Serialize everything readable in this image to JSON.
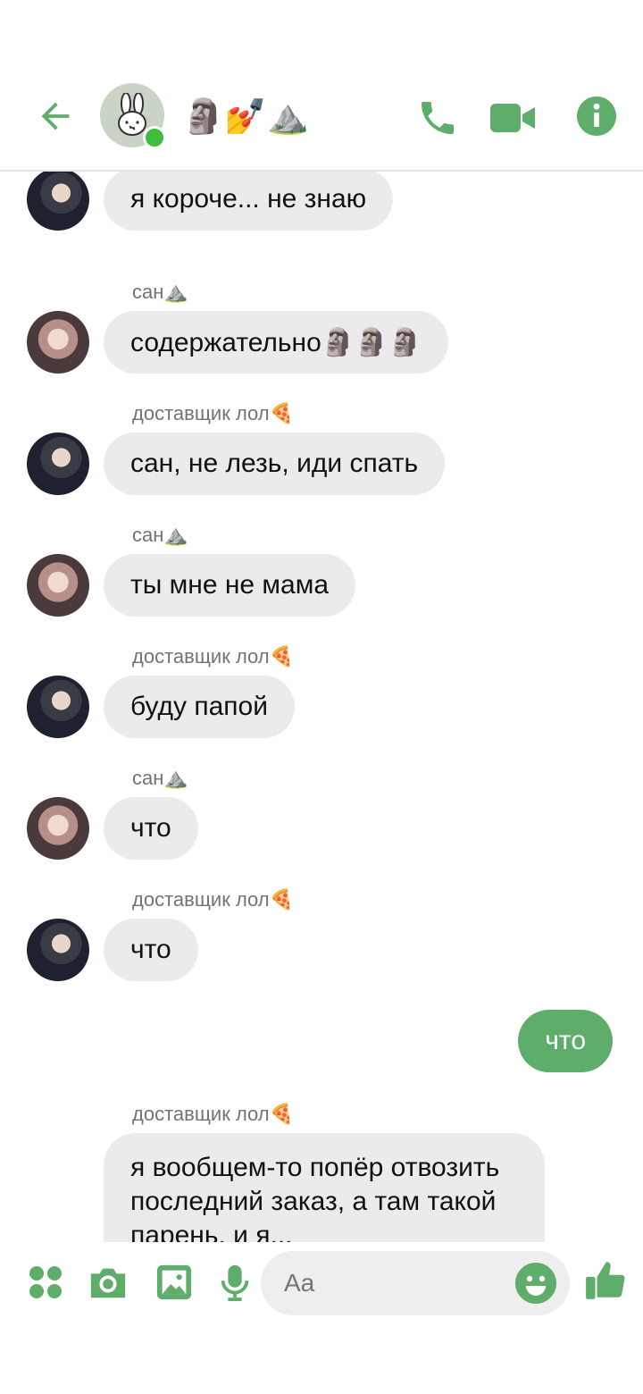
{
  "header": {
    "title": "🗿💅⛰️",
    "accent_color": "#5fad6a",
    "back_icon": "arrow-left-icon",
    "call_icon": "phone-icon",
    "video_icon": "video-camera-icon",
    "info_icon": "info-icon"
  },
  "messages": [
    {
      "sender": "",
      "text": "я короче... не знаю"
    },
    {
      "sender": "сан⛰️",
      "text": "содержательно🗿🗿🗿"
    },
    {
      "sender": "доставщик лол🍕",
      "text": "сан, не лезь, иди спать"
    },
    {
      "sender": "сан⛰️",
      "text": "ты мне не мама"
    },
    {
      "sender": "доставщик лол🍕",
      "text": "буду папой"
    },
    {
      "sender": "сан⛰️",
      "text": "что"
    },
    {
      "sender": "доставщик лол🍕",
      "text": "что"
    },
    {
      "sender": "",
      "text": "что"
    },
    {
      "sender": "доставщик лол🍕",
      "text": "я вообщем-то попёр отвозить последний заказ, а там такой парень, и я..."
    }
  ],
  "composer": {
    "placeholder": "Aa",
    "apps_icon": "apps-grid-icon",
    "camera_icon": "camera-icon",
    "gallery_icon": "image-icon",
    "mic_icon": "microphone-icon",
    "emoji_icon": "smiley-icon",
    "like_icon": "thumbs-up-icon"
  }
}
